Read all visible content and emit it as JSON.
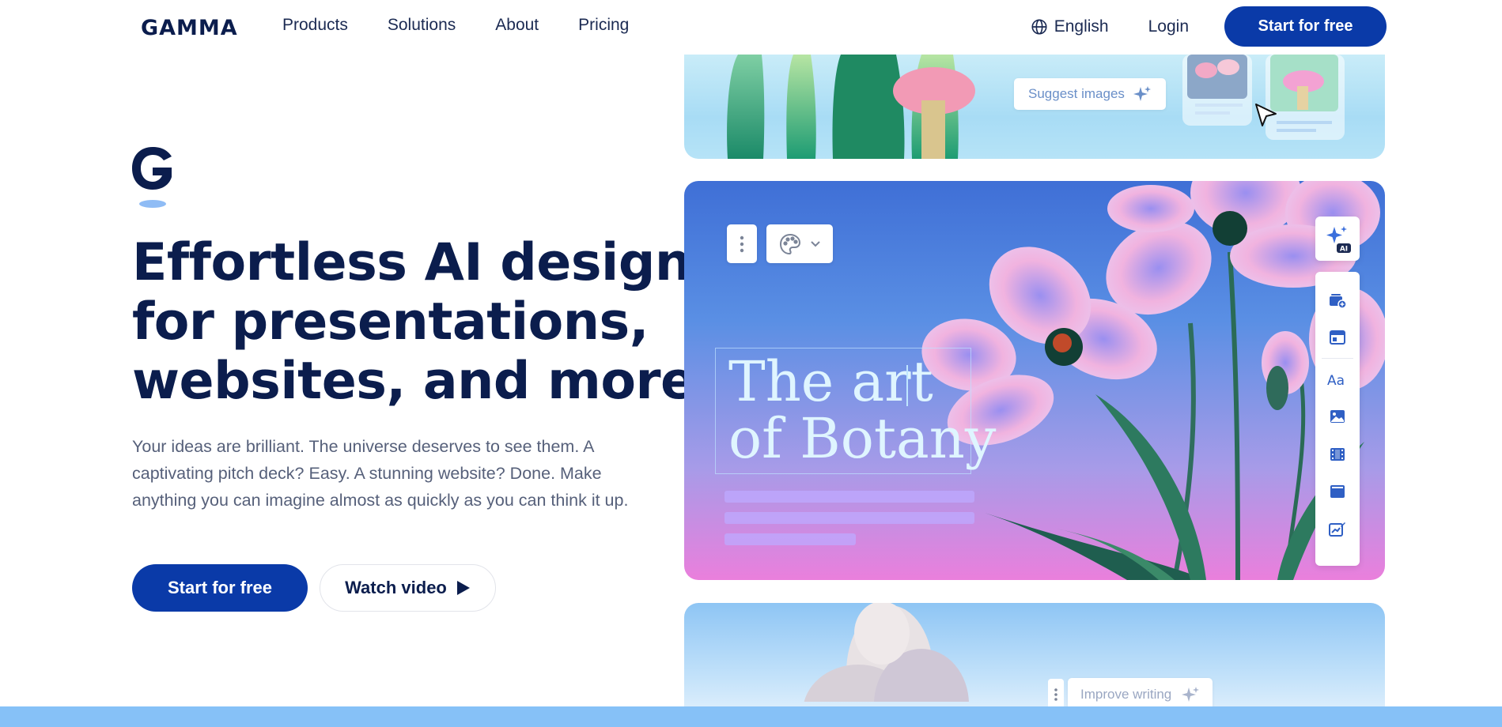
{
  "nav": {
    "logo": "GAMMA",
    "links": [
      "Products",
      "Solutions",
      "About",
      "Pricing"
    ],
    "language": "English",
    "login": "Login",
    "cta": "Start for free"
  },
  "hero": {
    "headline": [
      "Effortless AI design",
      "for presentations,",
      "websites, and more"
    ],
    "subtext": "Your ideas are brilliant. The universe deserves to see them. A captivating pitch deck? Easy. A stunning website? Done. Make anything you can imagine almost as quickly as you can think it up.",
    "cta_primary": "Start for free",
    "cta_secondary": "Watch video"
  },
  "cards": {
    "top": {
      "suggest_label": "Suggest images"
    },
    "main": {
      "title_lines": [
        "The art",
        "of Botany"
      ],
      "ai_badge": "AI",
      "tool_icons": [
        "add-card-icon",
        "layout-icon",
        "text-style-icon",
        "image-icon",
        "video-icon",
        "embed-icon",
        "chart-edit-icon"
      ]
    },
    "bottom": {
      "improve_label": "Improve writing"
    }
  },
  "colors": {
    "primary": "#0a3aa8",
    "heading": "#0b1d4d",
    "body_text": "#56607a",
    "band": "#86c1f7"
  }
}
